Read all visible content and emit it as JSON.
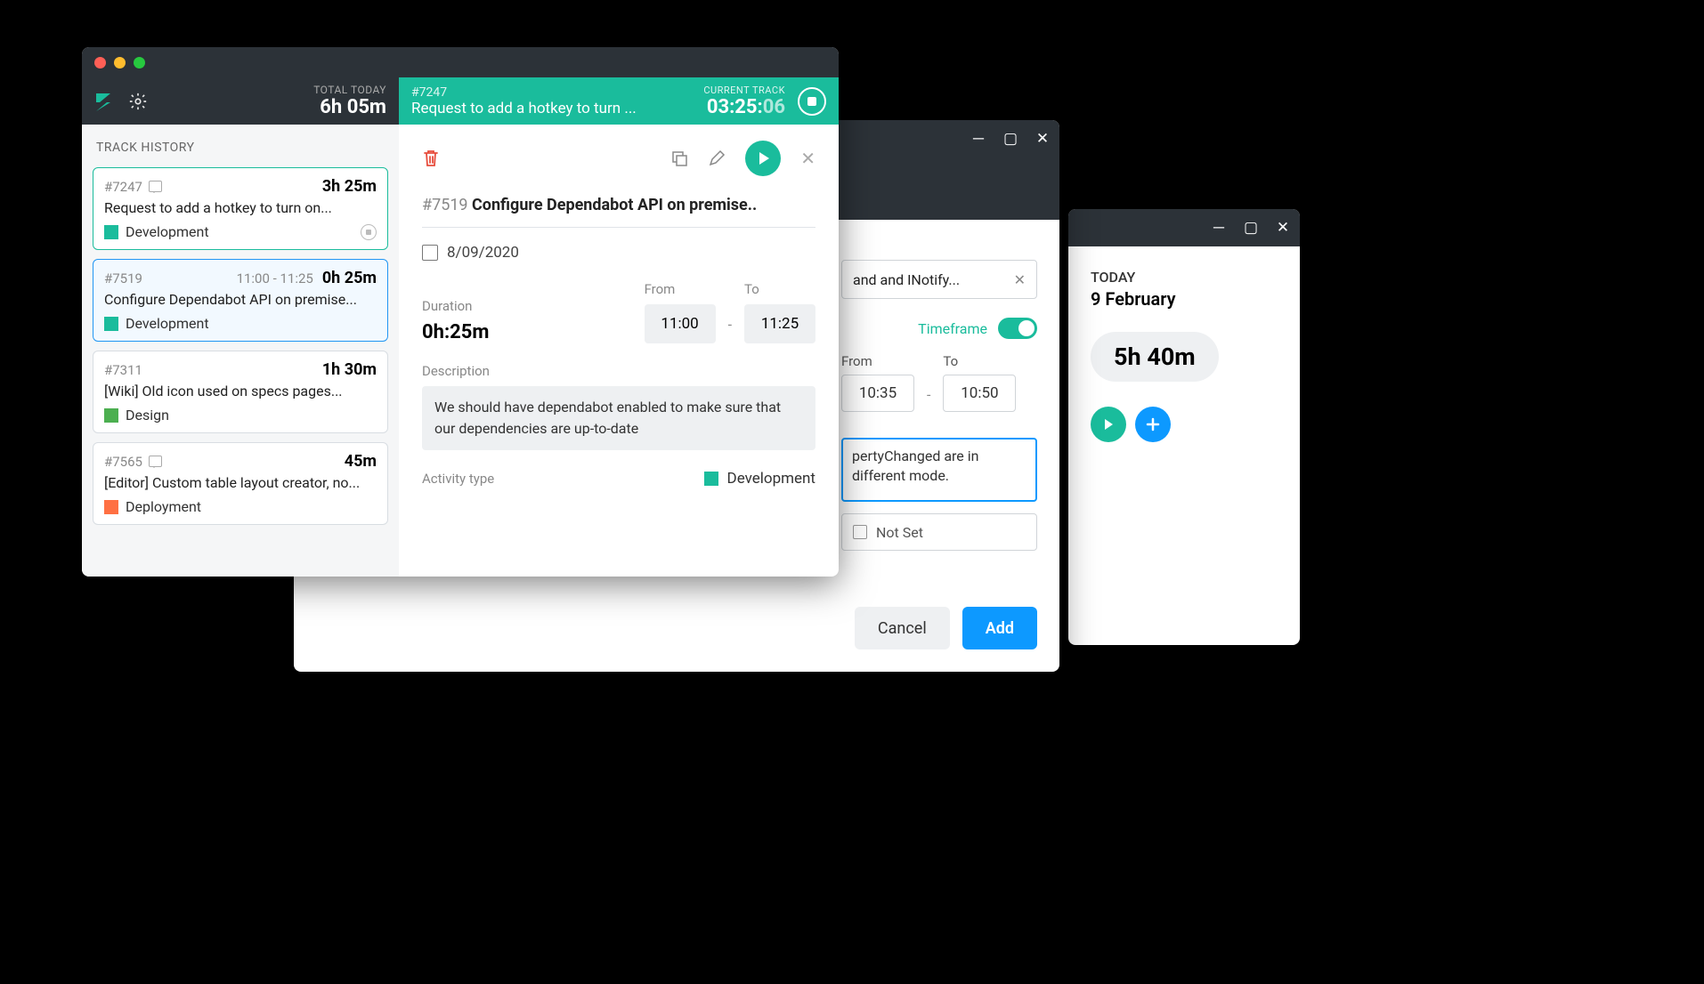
{
  "win3": {
    "today_label": "TODAY",
    "date": "9 February",
    "total": "5h 40m"
  },
  "win2": {
    "search_text": "and and INotify...",
    "timeframe_label": "Timeframe",
    "from_label": "From",
    "to_label": "To",
    "from_val": "10:35",
    "to_val": "10:50",
    "desc_text": "pertyChanged are in different mode.",
    "notset_label": "Not Set",
    "cancel": "Cancel",
    "add": "Add"
  },
  "win1": {
    "total_label": "TOTAL TODAY",
    "total_val": "6h 05m",
    "current_id": "#7247",
    "current_title": "Request to add a hotkey to turn ...",
    "current_label": "CURRENT TRACK",
    "current_time": "03:25:",
    "current_time_sec": "06",
    "history_title": "TRACK HISTORY",
    "tracks": {
      "t0": {
        "id": "#7247",
        "dur": "3h 25m",
        "title": "Request to add a hotkey to turn on...",
        "tag": "Development"
      },
      "t1": {
        "id": "#7519",
        "range": "11:00 - 11:25",
        "dur": "0h 25m",
        "title": "Configure Dependabot API on premise...",
        "tag": "Development"
      },
      "t2": {
        "id": "#7311",
        "dur": "1h 30m",
        "title": "[Wiki] Old icon used on specs pages...",
        "tag": "Design"
      },
      "t3": {
        "id": "#7565",
        "dur": "45m",
        "title": "[Editor] Custom table layout creator, no...",
        "tag": "Deployment"
      }
    },
    "detail": {
      "id": "#7519",
      "title": "Configure Dependabot API on premise..",
      "date": "8/09/2020",
      "dur_label": "Duration",
      "dur_val": "0h:25m",
      "from_label": "From",
      "to_label": "To",
      "from_val": "11:00",
      "to_val": "11:25",
      "desc_label": "Description",
      "desc_text": "We should have dependabot enabled to make sure that our dependencies are up-to-date",
      "activity_label": "Activity type",
      "activity_tag": "Development"
    }
  }
}
